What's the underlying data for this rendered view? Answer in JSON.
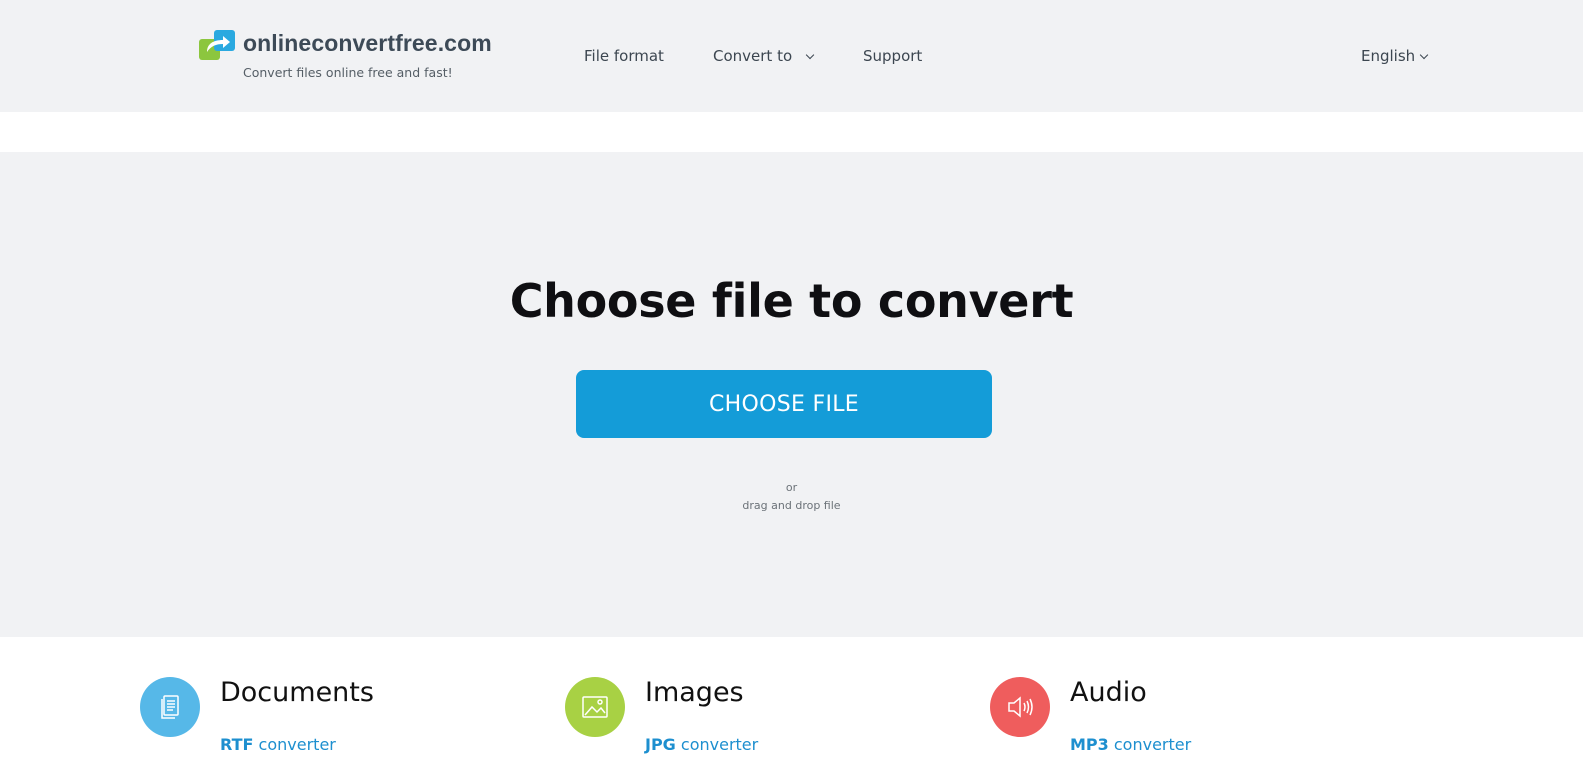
{
  "header": {
    "logo": {
      "name": "onlineconvertfree.com",
      "tagline": "Convert files online free and fast!",
      "colors": {
        "green": "#8cc63e",
        "blue": "#2aa9e0"
      }
    },
    "nav": {
      "file_format": "File format",
      "convert_to": "Convert to",
      "support": "Support",
      "language": "English"
    }
  },
  "hero": {
    "title": "Choose file to convert",
    "button_label": "CHOOSE FILE",
    "or_text": "or",
    "drop_text": "drag and drop file",
    "button_color": "#149cd8"
  },
  "categories": [
    {
      "title": "Documents",
      "icon": "document-icon",
      "color": "#56b8e8",
      "link_format": "RTF",
      "link_suffix": "converter"
    },
    {
      "title": "Images",
      "icon": "image-icon",
      "color": "#a8d144",
      "link_format": "JPG",
      "link_suffix": "converter"
    },
    {
      "title": "Audio",
      "icon": "speaker-icon",
      "color": "#ef5d5d",
      "link_format": "MP3",
      "link_suffix": "converter"
    }
  ]
}
